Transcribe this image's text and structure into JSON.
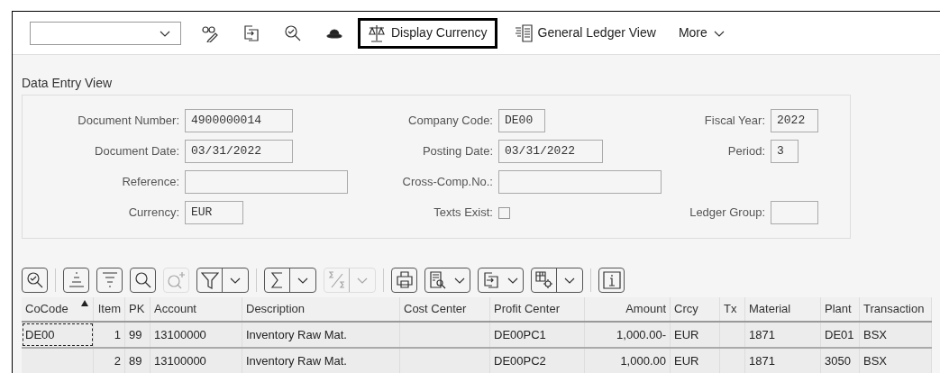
{
  "toolbar": {
    "icon_buttons": [
      {
        "kind": "glasses-pencil"
      },
      {
        "kind": "export"
      },
      {
        "kind": "check-search"
      },
      {
        "kind": "hat"
      }
    ],
    "text_buttons": [
      {
        "label": "Display Currency",
        "focused": true
      },
      {
        "label": "General Ledger View",
        "focused": false
      }
    ],
    "more": {
      "label": "More"
    }
  },
  "section_title": "Data Entry View",
  "form_rows": [
    [
      {
        "label": "Document Number:",
        "kind": "field",
        "value": "4900000014"
      },
      {
        "label": "Company Code:",
        "kind": "field",
        "value": "DE00"
      },
      {
        "label": "Fiscal Year:",
        "kind": "field",
        "value": "2022"
      }
    ],
    [
      {
        "label": "Document Date:",
        "kind": "field",
        "value": "03/31/2022"
      },
      {
        "label": "Posting Date:",
        "kind": "field",
        "value": "03/31/2022"
      },
      {
        "label": "Period:",
        "kind": "field",
        "value": "3"
      }
    ],
    [
      {
        "label": "Reference:",
        "kind": "field"
      },
      {
        "label": "Cross-Comp.No.:",
        "kind": "field"
      }
    ],
    [
      {
        "label": "Currency:",
        "kind": "field",
        "value": "EUR"
      },
      {
        "label": "Texts Exist:",
        "kind": "checkbox",
        "checked": false
      },
      {
        "label": "Ledger Group:",
        "kind": "field"
      }
    ]
  ],
  "table_toolbar": [
    [
      {
        "kind": "details",
        "disabled": false
      }
    ],
    [
      {
        "kind": "sort-asc",
        "disabled": false
      },
      {
        "kind": "sort-desc",
        "disabled": false
      },
      {
        "kind": "search",
        "disabled": false
      },
      {
        "kind": "search-plus",
        "disabled": true
      },
      {
        "kind": "filter",
        "disabled": false
      }
    ],
    [
      {
        "kind": "sum",
        "disabled": false
      },
      {
        "kind": "subtotal",
        "disabled": true
      }
    ],
    [
      {
        "kind": "print",
        "disabled": false
      },
      {
        "kind": "preview",
        "disabled": false
      },
      {
        "kind": "export",
        "disabled": false
      },
      {
        "kind": "layout",
        "disabled": false
      }
    ],
    [
      {
        "kind": "info",
        "disabled": false
      }
    ]
  ],
  "table": {
    "columns": [
      {
        "label": "CoCode",
        "sorted_ascending": true
      },
      {
        "label": "Item",
        "sorted_ascending": false
      },
      {
        "label": "PK",
        "sorted_ascending": false
      },
      {
        "label": "Account",
        "sorted_ascending": false
      },
      {
        "label": "Description",
        "sorted_ascending": false
      },
      {
        "label": "Cost Center",
        "sorted_ascending": false
      },
      {
        "label": "Profit Center",
        "sorted_ascending": false
      },
      {
        "label": "Amount",
        "sorted_ascending": false
      },
      {
        "label": "Crcy",
        "sorted_ascending": false
      },
      {
        "label": "Tx",
        "sorted_ascending": false
      },
      {
        "label": "Material",
        "sorted_ascending": false
      },
      {
        "label": "Plant",
        "sorted_ascending": false
      },
      {
        "label": "Transaction",
        "sorted_ascending": false
      }
    ],
    "rows": [
      {
        "focused_first_cell": true,
        "cells": [
          "DE00",
          "1",
          "99",
          "13100000",
          "Inventory Raw Mat.",
          "",
          "DE00PC1",
          "1,000.00-",
          "EUR",
          "",
          "1871",
          "DE01",
          "BSX"
        ]
      },
      {
        "focused_first_cell": false,
        "cells": [
          "",
          "2",
          "89",
          "13100000",
          "Inventory Raw Mat.",
          "",
          "DE00PC2",
          "1,000.00",
          "EUR",
          "",
          "1871",
          "3050",
          "BSX"
        ]
      }
    ]
  }
}
